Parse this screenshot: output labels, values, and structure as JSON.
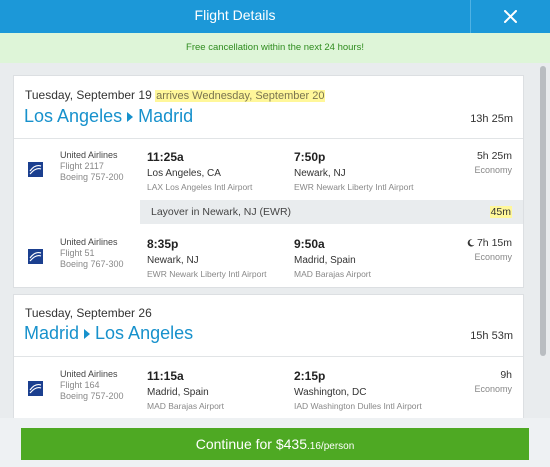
{
  "header": {
    "title": "Flight Details",
    "close_icon": "close-icon"
  },
  "notice": "Free cancellation within the next 24 hours!",
  "outbound": {
    "date": "Tuesday, September 19",
    "arrives_note": "arrives Wednesday, September 20",
    "origin": "Los Angeles",
    "destination": "Madrid",
    "total_duration": "13h 25m",
    "segments": [
      {
        "airline": "United Airlines",
        "flight": "Flight 2117",
        "aircraft": "Boeing 757-200",
        "depart_time": "11:25a",
        "depart_place": "Los Angeles, CA",
        "depart_airport": "LAX Los Angeles Intl Airport",
        "arrive_time": "7:50p",
        "arrive_place": "Newark, NJ",
        "arrive_airport": "EWR Newark Liberty Intl Airport",
        "duration": "5h 25m",
        "cabin": "Economy"
      },
      {
        "airline": "United Airlines",
        "flight": "Flight 51",
        "aircraft": "Boeing 767-300",
        "depart_time": "8:35p",
        "depart_place": "Newark, NJ",
        "depart_airport": "EWR Newark Liberty Intl Airport",
        "arrive_time": "9:50a",
        "arrive_place": "Madrid, Spain",
        "arrive_airport": "MAD Barajas Airport",
        "duration": "7h 15m",
        "cabin": "Economy",
        "overnight_icon": "moon-icon"
      }
    ],
    "layover": {
      "text": "Layover in Newark, NJ (EWR)",
      "duration": "45m"
    }
  },
  "return": {
    "date": "Tuesday, September 26",
    "origin": "Madrid",
    "destination": "Los Angeles",
    "total_duration": "15h 53m",
    "segments": [
      {
        "airline": "United Airlines",
        "flight": "Flight 164",
        "aircraft": "Boeing 757-200",
        "depart_time": "11:15a",
        "depart_place": "Madrid, Spain",
        "depart_airport": "MAD Barajas Airport",
        "arrive_time": "2:15p",
        "arrive_place": "Washington, DC",
        "arrive_airport": "IAD Washington Dulles Intl Airport",
        "duration": "9h",
        "cabin": "Economy"
      }
    ]
  },
  "cta": {
    "label": "Continue for $435",
    "cents": ".16/person"
  },
  "colors": {
    "header": "#1c98d8",
    "link": "#1791cc",
    "cta": "#4ea923",
    "highlight": "#fff79a",
    "notice_bg": "#def5d8"
  }
}
